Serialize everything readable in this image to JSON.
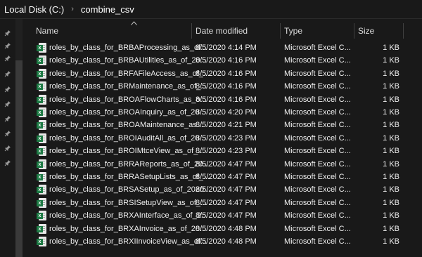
{
  "breadcrumb": {
    "items": [
      "Local Disk (C:)",
      "combine_csv"
    ],
    "separator": "›"
  },
  "columns": {
    "name": "Name",
    "date": "Date modified",
    "type": "Type",
    "size": "Size"
  },
  "rows": [
    {
      "name": "roles_by_class_for_BRBAProcessing_as_of...",
      "date": "8/5/2020 4:14 PM",
      "type": "Microsoft Excel C...",
      "size": "1 KB"
    },
    {
      "name": "roles_by_class_for_BRBAUtilities_as_of_20...",
      "date": "8/5/2020 4:16 PM",
      "type": "Microsoft Excel C...",
      "size": "1 KB"
    },
    {
      "name": "roles_by_class_for_BRFAFileAccess_as_of_...",
      "date": "8/5/2020 4:16 PM",
      "type": "Microsoft Excel C...",
      "size": "1 KB"
    },
    {
      "name": "roles_by_class_for_BRMaintenance_as_of_...",
      "date": "8/5/2020 4:16 PM",
      "type": "Microsoft Excel C...",
      "size": "1 KB"
    },
    {
      "name": "roles_by_class_for_BROAFlowCharts_as_o...",
      "date": "8/5/2020 4:16 PM",
      "type": "Microsoft Excel C...",
      "size": "1 KB"
    },
    {
      "name": "roles_by_class_for_BROAInquiry_as_of_20...",
      "date": "8/5/2020 4:20 PM",
      "type": "Microsoft Excel C...",
      "size": "1 KB"
    },
    {
      "name": "roles_by_class_for_BROAMaintenance_as...",
      "date": "8/5/2020 4:21 PM",
      "type": "Microsoft Excel C...",
      "size": "1 KB"
    },
    {
      "name": "roles_by_class_for_BROIAuditAll_as_of_20...",
      "date": "8/5/2020 4:23 PM",
      "type": "Microsoft Excel C...",
      "size": "1 KB"
    },
    {
      "name": "roles_by_class_for_BROIMtceView_as_of_...",
      "date": "8/5/2020 4:23 PM",
      "type": "Microsoft Excel C...",
      "size": "1 KB"
    },
    {
      "name": "roles_by_class_for_BRRAReports_as_of_20...",
      "date": "8/5/2020 4:47 PM",
      "type": "Microsoft Excel C...",
      "size": "1 KB"
    },
    {
      "name": "roles_by_class_for_BRRASetupLists_as_of_...",
      "date": "8/5/2020 4:47 PM",
      "type": "Microsoft Excel C...",
      "size": "1 KB"
    },
    {
      "name": "roles_by_class_for_BRSASetup_as_of_2020...",
      "date": "8/5/2020 4:47 PM",
      "type": "Microsoft Excel C...",
      "size": "1 KB"
    },
    {
      "name": "roles_by_class_for_BRSISetupView_as_of_...",
      "date": "8/5/2020 4:47 PM",
      "type": "Microsoft Excel C...",
      "size": "1 KB"
    },
    {
      "name": "roles_by_class_for_BRXAInterface_as_of_2...",
      "date": "8/5/2020 4:47 PM",
      "type": "Microsoft Excel C...",
      "size": "1 KB"
    },
    {
      "name": "roles_by_class_for_BRXAInvoice_as_of_20...",
      "date": "8/5/2020 4:48 PM",
      "type": "Microsoft Excel C...",
      "size": "1 KB"
    },
    {
      "name": "roles_by_class_for_BRXIInvoiceView_as_of...",
      "date": "8/5/2020 4:48 PM",
      "type": "Microsoft Excel C...",
      "size": "1 KB"
    }
  ],
  "icons": {
    "file": "excel-csv-icon",
    "quick_access": "pin-icon",
    "sort": "sort-ascending-icon"
  },
  "colors": {
    "background": "#191919",
    "text": "#ffffff",
    "excel_green": "#1d7a44"
  }
}
